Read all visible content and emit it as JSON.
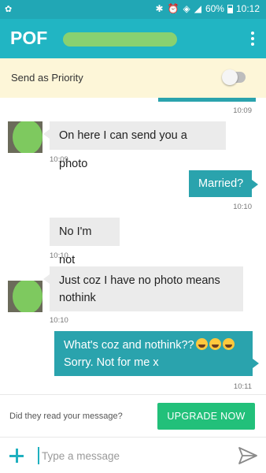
{
  "status": {
    "battery": "60%",
    "time": "10:12",
    "icons": [
      "notification-icon",
      "bluetooth-icon",
      "alarm-icon",
      "wifi-icon",
      "signal-icon",
      "battery-icon"
    ]
  },
  "header": {
    "logo": "POF",
    "menu_icon": "more-vert-icon"
  },
  "priority": {
    "label": "Send as Priority",
    "toggle_on": false
  },
  "messages": [
    {
      "direction": "out",
      "time": "10:09"
    },
    {
      "direction": "in",
      "text": "On here I can send you a photo",
      "time": "10:09"
    },
    {
      "direction": "out",
      "text": "Married?",
      "time": "10:10"
    },
    {
      "direction": "in",
      "text": "No I'm not",
      "time": "10:10"
    },
    {
      "direction": "in",
      "line1": "Just coz I have no photo means",
      "line2": "nothink",
      "time": "10:10"
    },
    {
      "direction": "out",
      "line1": "What's coz and nothink??",
      "emoji": "rofl-emoji",
      "line2": "Sorry. Not for me x",
      "time": "10:11"
    }
  ],
  "footer": {
    "read_prompt": "Did they read your message?",
    "upgrade_label": "UPGRADE NOW"
  },
  "compose": {
    "placeholder": "Type a message",
    "value": ""
  },
  "colors": {
    "status_bar": "#21a7b5",
    "app_bar": "#21b5c3",
    "outgoing_bubble": "#2aa3ad",
    "incoming_bubble": "#ebebeb",
    "upgrade_button": "#22c07a"
  }
}
